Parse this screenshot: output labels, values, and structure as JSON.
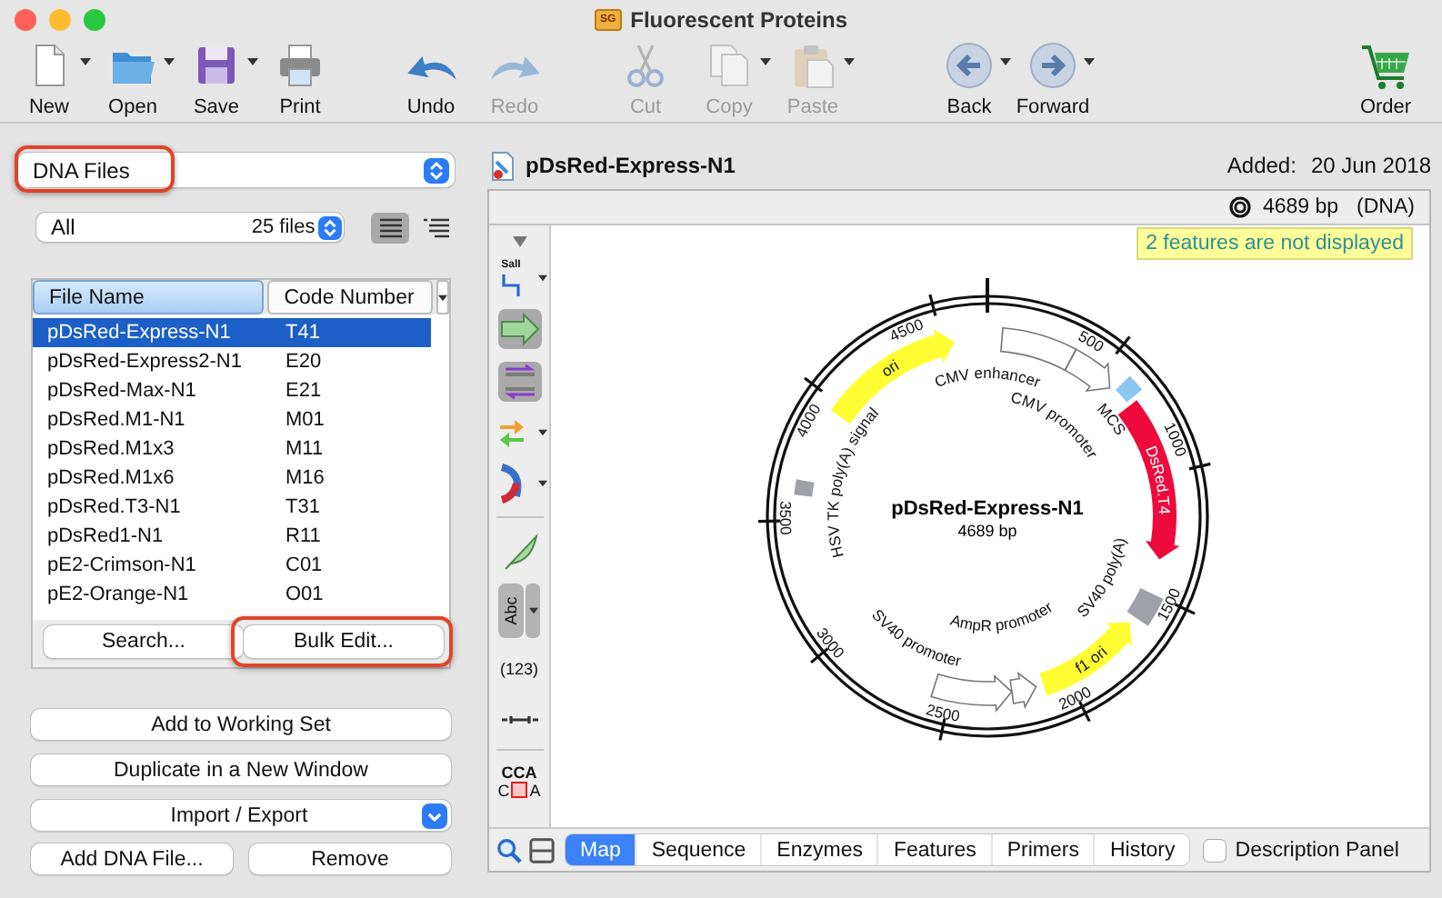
{
  "window": {
    "title": "Fluorescent Proteins",
    "badge": "SG"
  },
  "toolbar": [
    {
      "label": "New",
      "kind": "new",
      "menu": true,
      "disabled": false
    },
    {
      "label": "Open",
      "kind": "open",
      "menu": true,
      "disabled": false
    },
    {
      "label": "Save",
      "kind": "save",
      "menu": true,
      "disabled": false
    },
    {
      "label": "Print",
      "kind": "print",
      "menu": false,
      "disabled": false
    },
    {
      "label": "Undo",
      "kind": "undo",
      "menu": false,
      "disabled": false
    },
    {
      "label": "Redo",
      "kind": "redo",
      "menu": false,
      "disabled": true
    },
    {
      "label": "Cut",
      "kind": "cut",
      "menu": false,
      "disabled": true
    },
    {
      "label": "Copy",
      "kind": "copy",
      "menu": true,
      "disabled": true
    },
    {
      "label": "Paste",
      "kind": "paste",
      "menu": true,
      "disabled": true
    },
    {
      "label": "Back",
      "kind": "back",
      "menu": true,
      "disabled": false
    },
    {
      "label": "Forward",
      "kind": "forward",
      "menu": true,
      "disabled": false
    },
    {
      "label": "Order",
      "kind": "order",
      "menu": false,
      "disabled": false
    }
  ],
  "sidebar": {
    "collection": {
      "value": "DNA Files",
      "highlighted": true
    },
    "filter": {
      "value": "All",
      "count": "25 files"
    },
    "view_modes": [
      {
        "kind": "list",
        "selected": true
      },
      {
        "kind": "outline",
        "selected": false
      }
    ],
    "columns": [
      {
        "label": "File Name",
        "selected": true
      },
      {
        "label": "Code Number",
        "selected": false
      }
    ],
    "rows": [
      {
        "name": "pDsRed-Express-N1",
        "code": "T41",
        "selected": true
      },
      {
        "name": "pDsRed-Express2-N1",
        "code": "E20",
        "selected": false
      },
      {
        "name": "pDsRed-Max-N1",
        "code": "E21",
        "selected": false
      },
      {
        "name": "pDsRed.M1-N1",
        "code": "M01",
        "selected": false
      },
      {
        "name": "pDsRed.M1x3",
        "code": "M11",
        "selected": false
      },
      {
        "name": "pDsRed.M1x6",
        "code": "M16",
        "selected": false
      },
      {
        "name": "pDsRed.T3-N1",
        "code": "T31",
        "selected": false
      },
      {
        "name": "pDsRed1-N1",
        "code": "R11",
        "selected": false
      },
      {
        "name": "pE2-Crimson-N1",
        "code": "C01",
        "selected": false
      },
      {
        "name": "pE2-Orange-N1",
        "code": "O01",
        "selected": false
      }
    ],
    "list_buttons": [
      {
        "label": "Search...",
        "highlighted": false
      },
      {
        "label": "Bulk Edit...",
        "highlighted": true
      }
    ],
    "actions": [
      {
        "label": "Add to Working Set",
        "kind": "button"
      },
      {
        "label": "Duplicate in a New Window",
        "kind": "button"
      },
      {
        "label": "Import / Export",
        "kind": "menu"
      }
    ],
    "footer_buttons": [
      "Add DNA File...",
      "Remove"
    ]
  },
  "document": {
    "name": "pDsRed-Express-N1",
    "added_label": "Added:",
    "added_date": "20 Jun 2018",
    "length": "4689 bp",
    "molecule": "(DNA)",
    "notice": "2 features are not displayed",
    "tools": [
      {
        "kind": "collapse"
      },
      {
        "kind": "enzyme",
        "label": "SalI",
        "menu": true,
        "selected": false
      },
      {
        "kind": "feature",
        "selected": true
      },
      {
        "kind": "primer",
        "selected": true
      },
      {
        "kind": "orf",
        "menu": true,
        "selected": false
      },
      {
        "kind": "arc",
        "menu": true,
        "selected": false
      },
      {
        "kind": "divider"
      },
      {
        "kind": "leaf",
        "selected": false
      },
      {
        "kind": "text",
        "label": "Abc",
        "menu": true,
        "selected": true
      },
      {
        "kind": "numbers",
        "label": "(123)",
        "selected": false
      },
      {
        "kind": "ruler",
        "selected": false
      },
      {
        "kind": "divider"
      },
      {
        "kind": "translation",
        "label": "CCA",
        "left": "C",
        "right": "A",
        "selected": false
      }
    ],
    "map": {
      "name": "pDsRed-Express-N1",
      "length": "4689 bp",
      "scale": [
        "500",
        "1000",
        "1500",
        "2000",
        "2500",
        "3000",
        "3500",
        "4000",
        "4500"
      ],
      "features": [
        {
          "label": "ori",
          "kind": "arrow",
          "reverse": false,
          "color": "#ffff33"
        },
        {
          "label": "CMV enhancer",
          "kind": "segment",
          "color": "#ffffff"
        },
        {
          "label": "CMV promoter",
          "kind": "arrow",
          "reverse": false,
          "color": "#ffffff"
        },
        {
          "label": "MCS",
          "kind": "box",
          "color": "#8ec6f2"
        },
        {
          "label": "DsRed.T4",
          "kind": "arrow",
          "reverse": false,
          "color": "#ee0a3c"
        },
        {
          "label": "SV40 poly(A)",
          "kind": "box",
          "color": "#9ea2a8"
        },
        {
          "label": "f1 ori",
          "kind": "arrow",
          "reverse": true,
          "color": "#ffff33"
        },
        {
          "label": "AmpR promoter",
          "kind": "arrow",
          "reverse": true,
          "color": "#ffffff"
        },
        {
          "label": "SV40 promoter",
          "kind": "arrow",
          "reverse": true,
          "color": "#ffffff"
        },
        {
          "label": "HSV TK poly(A) signal",
          "kind": "box",
          "color": "#9ea2a8"
        }
      ]
    },
    "tabs": [
      {
        "label": "Map",
        "selected": true
      },
      {
        "label": "Sequence",
        "selected": false
      },
      {
        "label": "Enzymes",
        "selected": false
      },
      {
        "label": "Features",
        "selected": false
      },
      {
        "label": "Primers",
        "selected": false
      },
      {
        "label": "History",
        "selected": false
      }
    ],
    "description_panel": {
      "label": "Description Panel",
      "checked": false
    }
  }
}
